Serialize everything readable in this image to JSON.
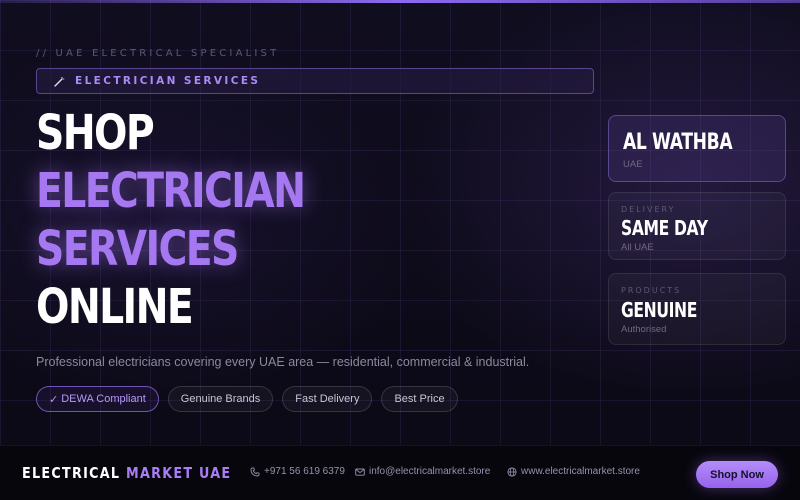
{
  "hero": {
    "kicker": "// UAE ELECTRICAL SPECIALIST",
    "tag": "ELECTRICIAN SERVICES",
    "headline": [
      "SHOP",
      "ELECTRICIAN",
      "SERVICES",
      "ONLINE"
    ],
    "description": "Professional electricians covering every UAE area — residential, commercial & industrial.",
    "pills": [
      {
        "check": "✓",
        "label": "DEWA Compliant"
      },
      {
        "label": "Genuine Brands"
      },
      {
        "label": "Fast Delivery"
      },
      {
        "label": "Best Price"
      }
    ]
  },
  "cards": [
    {
      "title": "AL WATHBA",
      "subtitle": "UAE"
    },
    {
      "label": "DELIVERY",
      "title": "SAME DAY",
      "subtitle": "All UAE"
    },
    {
      "label": "PRODUCTS",
      "title": "GENUINE",
      "subtitle": "Authorised"
    }
  ],
  "footer": {
    "brand_part1": "ELECTRICAL",
    "brand_part2": "MARKET UAE",
    "phone": "+971 56 619 6379",
    "email": "info@electricalmarket.store",
    "website": "www.electricalmarket.store",
    "cta": "Shop Now"
  },
  "icons": {
    "tag": "magic-wand-icon",
    "phone": "phone-icon",
    "email": "mail-icon",
    "website": "globe-icon"
  },
  "colors": {
    "accent": "#a578f2",
    "background": "#0d0b18",
    "button": "#9f72f0"
  }
}
